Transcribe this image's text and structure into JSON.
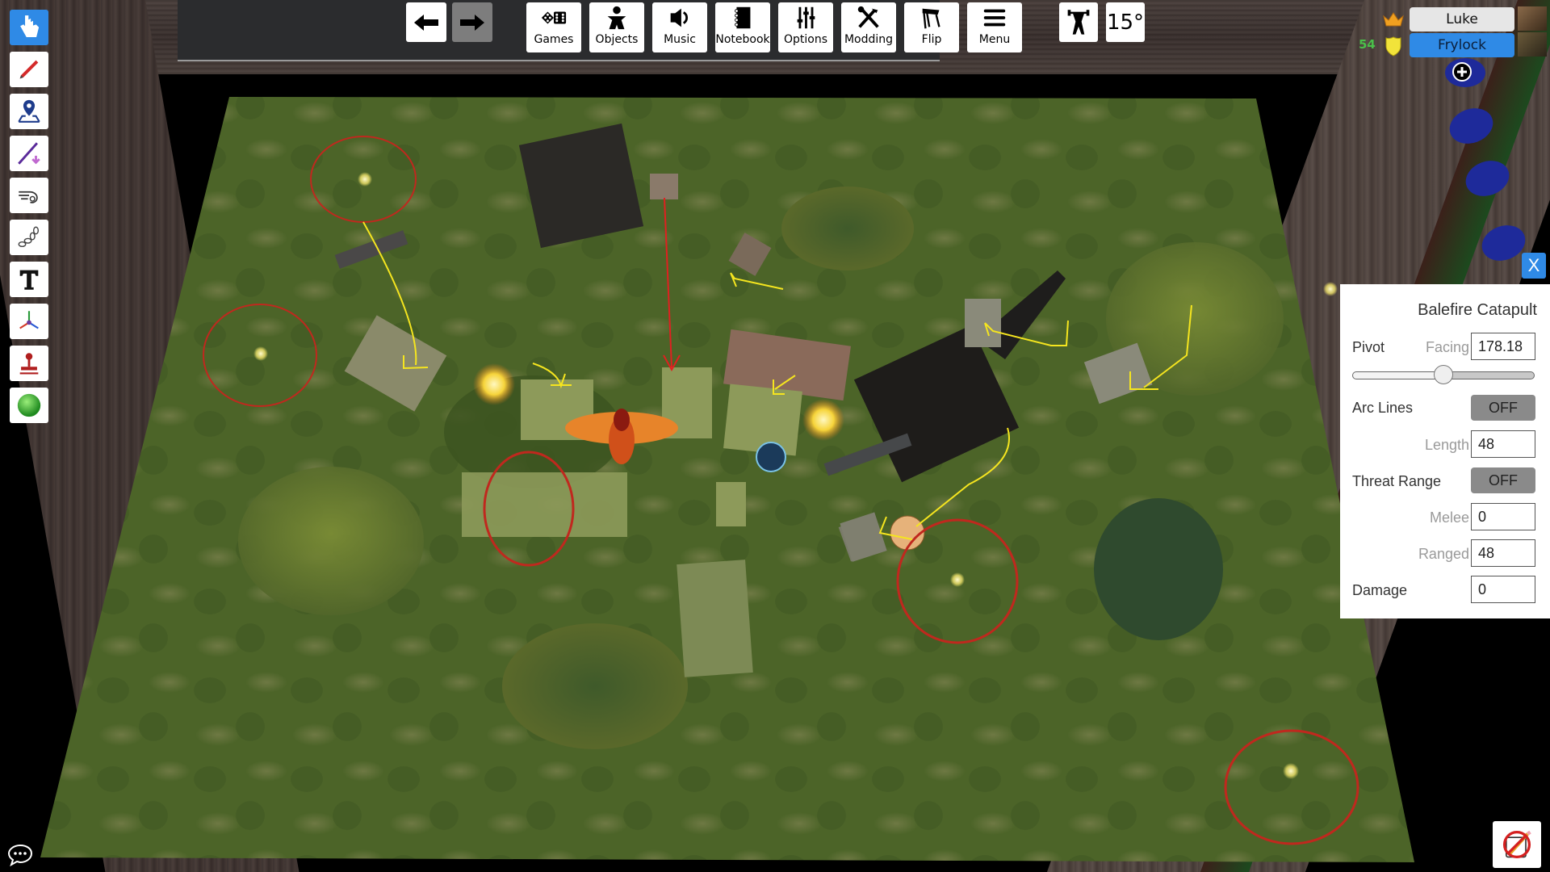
{
  "toolbar_left": {
    "tools": [
      {
        "name": "grab-tool",
        "icon": "pointer-hand-icon",
        "active": true
      },
      {
        "name": "pen-tool",
        "icon": "pencil-icon",
        "active": false
      },
      {
        "name": "zone-tool",
        "icon": "map-pin-icon",
        "active": false
      },
      {
        "name": "line-tool",
        "icon": "line-measure-icon",
        "active": false
      },
      {
        "name": "flick-tool",
        "icon": "flick-hand-icon",
        "active": false
      },
      {
        "name": "joint-tool",
        "icon": "chain-icon",
        "active": false
      },
      {
        "name": "text-tool",
        "icon": "text-icon",
        "active": false
      },
      {
        "name": "gizmo-tool",
        "icon": "axes-icon",
        "active": false
      },
      {
        "name": "snap-tool",
        "icon": "stamp-icon",
        "active": false
      },
      {
        "name": "decal-tool",
        "icon": "green-sphere-icon",
        "active": false
      }
    ]
  },
  "toolbar_top": {
    "undo_icon": "arrow-left-icon",
    "redo_icon": "arrow-right-icon",
    "buttons": [
      {
        "label": "Games",
        "icon": "dice-icon"
      },
      {
        "label": "Objects",
        "icon": "meeple-icon"
      },
      {
        "label": "Music",
        "icon": "speaker-icon"
      },
      {
        "label": "Notebook",
        "icon": "notebook-icon"
      },
      {
        "label": "Options",
        "icon": "sliders-icon"
      },
      {
        "label": "Modding",
        "icon": "tools-icon"
      },
      {
        "label": "Flip",
        "icon": "flip-table-icon"
      },
      {
        "label": "Menu",
        "icon": "hamburger-icon"
      }
    ],
    "strength_icon": "weightlifter-icon",
    "rotation_label": "15°"
  },
  "players": [
    {
      "name": "Luke",
      "badge_icon": "crown-icon",
      "color": "#e6e6e6",
      "text_color": "#111111"
    },
    {
      "name": "Frylock",
      "badge_icon": "shield-badge-icon",
      "score": "54",
      "color": "#2f8ae6",
      "text_color": "#0b1f3a"
    }
  ],
  "add_player_icon": "plus-circle-icon",
  "panel": {
    "title": "Balefire Catapult",
    "pivot_label": "Pivot",
    "facing_label": "Facing",
    "facing_value": "178.18",
    "slider_fraction": 0.5,
    "arc_lines_label": "Arc Lines",
    "arc_lines_state": "OFF",
    "length_label": "Length",
    "length_value": "48",
    "threat_range_label": "Threat Range",
    "threat_range_state": "OFF",
    "melee_label": "Melee",
    "melee_value": "0",
    "ranged_label": "Ranged",
    "ranged_value": "48",
    "damage_label": "Damage",
    "damage_value": "0",
    "close_label": "X"
  },
  "bottom": {
    "chat_icon": "chat-bubble-icon",
    "no_draw_icon": "no-drawing-icon"
  },
  "colors": {
    "accent": "#2f8ae6",
    "toggle_off": "#8a8a8a",
    "range_ring": "#c0281e",
    "movement_line": "#f5e51f",
    "charge_line": "#e02020",
    "grass": "#4f6b2a"
  }
}
